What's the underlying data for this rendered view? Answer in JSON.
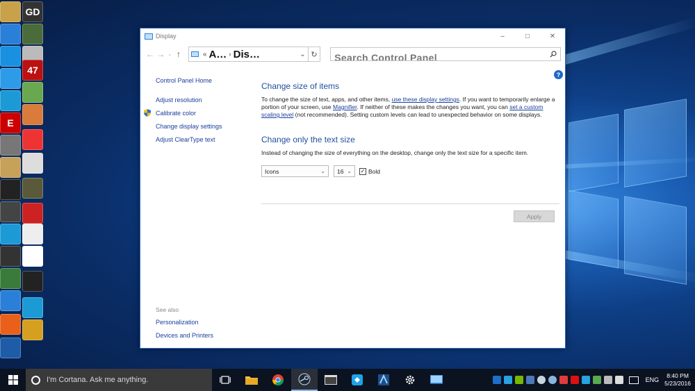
{
  "window": {
    "title": "Display",
    "controls": {
      "minimize": "–",
      "maximize": "□",
      "close": "✕"
    }
  },
  "navbar": {
    "back": "←",
    "forward": "→",
    "recent": "⌄",
    "up": "↑",
    "breadcrumb_sep": "«",
    "crumb1": "A…",
    "crumb_sep": "›",
    "crumb2": "Dis…",
    "refresh": "↻",
    "search_placeholder": "Search Control Panel"
  },
  "sidebar": {
    "home": "Control Panel Home",
    "links": [
      "Adjust resolution",
      "Calibrate color",
      "Change display settings",
      "Adjust ClearType text"
    ],
    "see_also_label": "See also",
    "see_also": [
      "Personalization",
      "Devices and Printers"
    ]
  },
  "content": {
    "section1_title": "Change size of items",
    "p1_a": "To change the size of text, apps, and other items, ",
    "p1_link1": "use these display settings",
    "p1_b": ".  If you want to temporarily enlarge a portion of your screen, use ",
    "p1_link2": "Magnifier",
    "p1_c": ".  If neither of these makes the changes you want, you can ",
    "p1_link3": "set a custom scaling level",
    "p1_d": " (not recommended).  Setting custom levels can lead to unexpected behavior on some displays.",
    "section2_title": "Change only the text size",
    "p2": "Instead of changing the size of everything on the desktop, change only the text size for a specific item.",
    "item_select": "Icons",
    "size_select": "16",
    "bold_label": "Bold",
    "bold_checked": "✓",
    "apply_label": "Apply"
  },
  "taskbar": {
    "cortana_text": "I'm Cortana. Ask me anything.",
    "language": "ENG",
    "time": "8:40 PM",
    "date": "5/23/2016"
  },
  "desktop_icons": {
    "gd": "GD",
    "n47": "47",
    "e": "E"
  },
  "colors": {
    "accent": "#1e4f9e",
    "link": "#1a3e9c",
    "window_border": "#2b67c7",
    "taskbar": "#0b1220"
  }
}
